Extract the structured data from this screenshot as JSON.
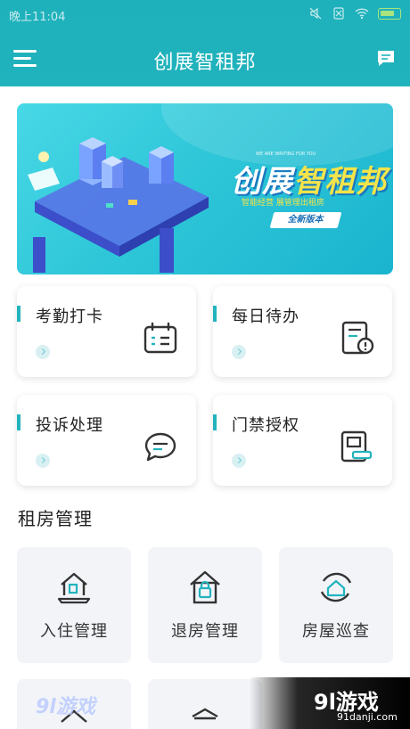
{
  "status_bar": {
    "time": "晚上11:04"
  },
  "header": {
    "title": "创展智租邦"
  },
  "banner": {
    "small_text": "WE ARE WRITING FOR YOU",
    "title_part1": "创展",
    "title_part2": "智租邦",
    "subtitle": "智能经营 展管理出租房",
    "badge": "全新版本"
  },
  "cards": [
    {
      "label": "考勤打卡",
      "icon": "calendar-check-icon"
    },
    {
      "label": "每日待办",
      "icon": "clipboard-alert-icon"
    },
    {
      "label": "投诉处理",
      "icon": "chat-bubble-icon"
    },
    {
      "label": "门禁授权",
      "icon": "access-card-icon"
    }
  ],
  "section": {
    "title": "租房管理"
  },
  "tiles": [
    {
      "label": "入住管理",
      "icon": "house-laptop-icon"
    },
    {
      "label": "退房管理",
      "icon": "house-lock-icon"
    },
    {
      "label": "房屋巡查",
      "icon": "house-refresh-icon"
    }
  ],
  "watermark": {
    "logo": "9l游戏",
    "site": "91danji.com",
    "left_logo": "9l游戏"
  },
  "colors": {
    "primary": "#20b3bd",
    "tile_bg": "#f2f4f8"
  }
}
